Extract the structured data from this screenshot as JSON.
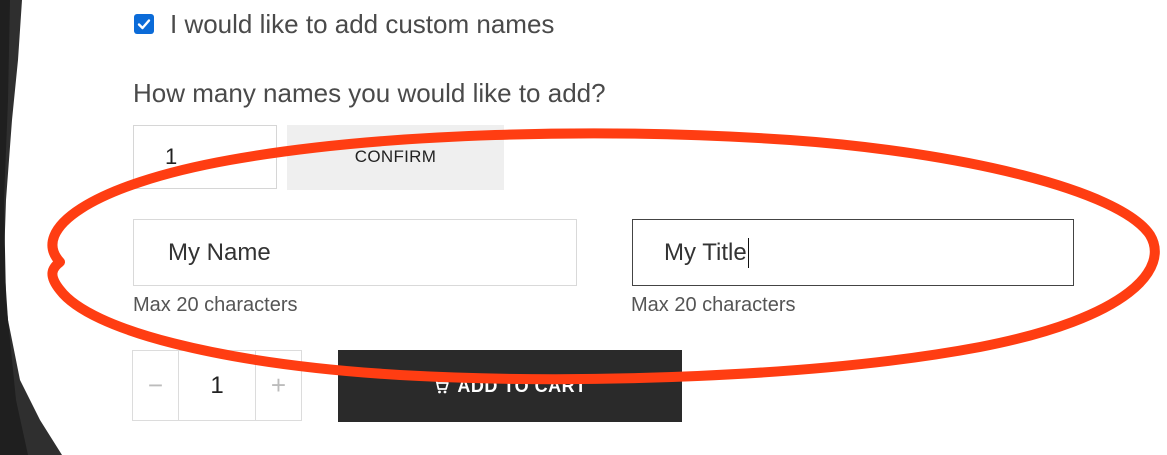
{
  "custom_names": {
    "checkbox_label": "I would like to add custom names",
    "checked": true
  },
  "names_count": {
    "question": "How many names you would like to add?",
    "value": "1",
    "confirm_label": "CONFIRM"
  },
  "fields": [
    {
      "value": "My Name",
      "hint": "Max 20 characters"
    },
    {
      "value": "My Title",
      "hint": "Max 20 characters"
    }
  ],
  "cart": {
    "quantity": "1",
    "minus_label": "−",
    "plus_label": "+",
    "add_to_cart_label": "ADD TO CART"
  },
  "colors": {
    "highlight": "#ff3d12",
    "button_dark": "#2a2a2a",
    "checkbox": "#0b6bd8"
  },
  "icons": [
    "checkmark-icon",
    "cart-icon"
  ]
}
